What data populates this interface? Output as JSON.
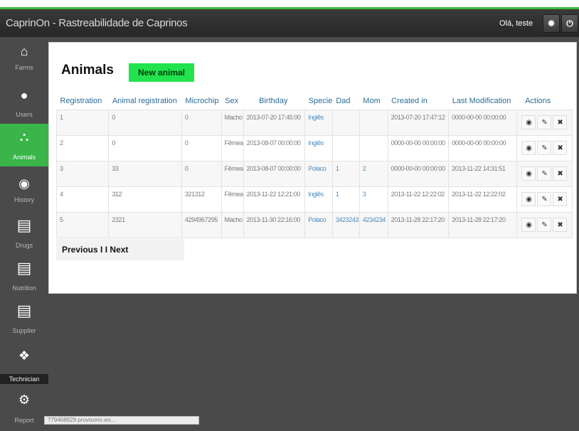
{
  "window": {
    "title": "CaprinOn - Rastreabilidade de Caprinos"
  },
  "header": {
    "greeting": "Olá, teste",
    "settings_icon": "gear-icon",
    "power_icon": "power-icon"
  },
  "sidebar": {
    "items": [
      {
        "label": "Farms",
        "icon": "home-icon",
        "glyph": "🏠"
      },
      {
        "label": "Users",
        "icon": "user-icon",
        "glyph": "👤"
      },
      {
        "label": "Animals",
        "icon": "sitemap-icon",
        "glyph": "⛬",
        "active": true
      },
      {
        "label": "History",
        "icon": "history-icon",
        "glyph": "◉"
      },
      {
        "label": "Drugs",
        "icon": "document-icon",
        "glyph": "▤"
      },
      {
        "label": "Nutrition",
        "icon": "document-icon",
        "glyph": "▤"
      },
      {
        "label": "Supplier",
        "icon": "document-icon",
        "glyph": "▤"
      },
      {
        "label": "Technician",
        "icon": "group-icon",
        "glyph": "👥"
      },
      {
        "label": "Report",
        "icon": "cogs-icon",
        "glyph": "⚙"
      }
    ]
  },
  "main": {
    "title": "Animals",
    "new_button": "New animal",
    "table": {
      "headers": [
        "Registration",
        "Animal registration",
        "Microchip",
        "Sex",
        "Birthday",
        "Specie",
        "Dad",
        "Mom",
        "Created in",
        "Last Modification",
        "Actions"
      ],
      "rows": [
        [
          "1",
          "0",
          "0",
          "Macho",
          "2013-07-20 17:45:00",
          "Inglês",
          "",
          "",
          "2013-07-20 17:47:12",
          "0000-00-00 00:00:00"
        ],
        [
          "2",
          "0",
          "0",
          "Fêmea",
          "2013-08-07 00:00:00",
          "Inglês",
          "",
          "",
          "0000-00-00 00:00:00",
          "0000-00-00 00:00:00"
        ],
        [
          "3",
          "33",
          "0",
          "Fêmea",
          "2013-08-07 00:00:00",
          "Polaco",
          "1",
          "2",
          "0000-00-00 00:00:00",
          "2013-11-22 14:31:51"
        ],
        [
          "4",
          "312",
          "321312",
          "Fêmea",
          "2013-11-22 12:21:00",
          "Inglês",
          "1",
          "3",
          "2013-11-22 12:22:02",
          "2013-11-22 12:22:02"
        ],
        [
          "5",
          "2321",
          "4294967295",
          "Macho",
          "2013-11-30 22:16:00",
          "Polaco",
          "3423243",
          "4234234",
          "2013-11-28 22:17:20",
          "2013-11-28 22:17:20"
        ]
      ],
      "actions": {
        "view": "◉",
        "edit": "✎",
        "delete": "✖"
      }
    },
    "pager": {
      "previous": "Previous",
      "separator": "I I",
      "next": "Next"
    }
  },
  "status": {
    "url": "?79468829.provisorio.ws..."
  }
}
